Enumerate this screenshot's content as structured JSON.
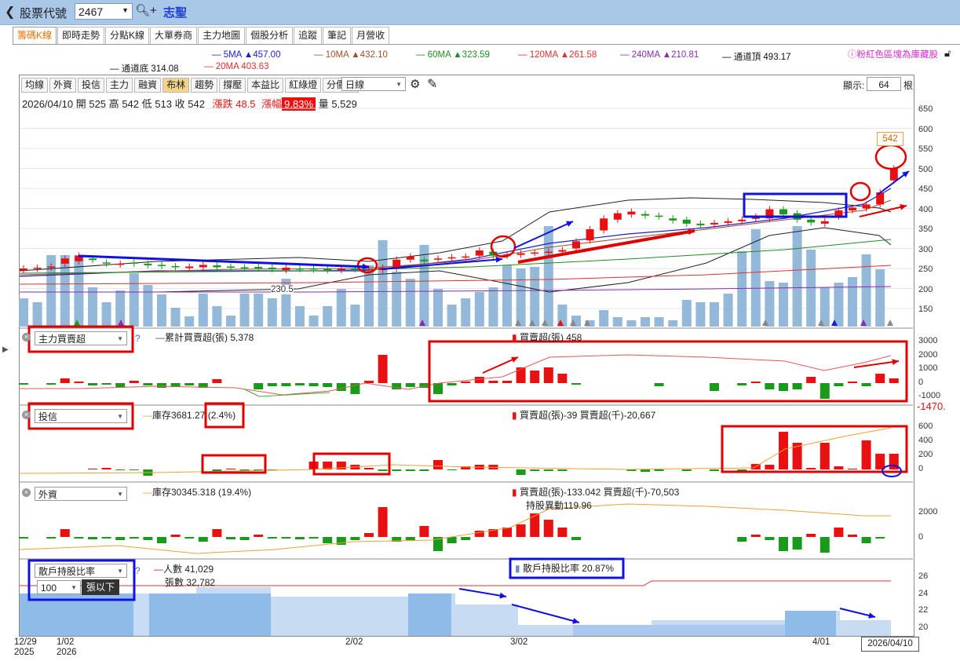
{
  "header": {
    "back_label": "❮",
    "stock_label": "股票代號",
    "stock_code": "2467",
    "stock_name": "志聖"
  },
  "tabs": [
    "籌碼K線",
    "即時走勢",
    "分點K線",
    "大單券商",
    "主力地圖",
    "個股分析",
    "追蹤",
    "筆記",
    "月營收"
  ],
  "ma_legend": [
    {
      "label": "5MA ▲457.00",
      "color": "#1d1dcf"
    },
    {
      "label": "10MA ▲432.10",
      "color": "#a0522d"
    },
    {
      "label": "60MA ▲323.59",
      "color": "#228b22"
    },
    {
      "label": "120MA ▲261.58",
      "color": "#e03030"
    },
    {
      "label": "240MA ▲210.81",
      "color": "#8b2bb0"
    },
    {
      "label": "通道頂 493.17",
      "color": "#111111"
    },
    {
      "label": "通道底 314.08",
      "color": "#111111"
    },
    {
      "label": "20MA 403.63",
      "color": "#e03030"
    }
  ],
  "pink_note": "粉紅色區塊為庫藏股",
  "toolbar": {
    "buttons": [
      "均線",
      "外資",
      "投信",
      "主力",
      "融資",
      "布林",
      "趨勢",
      "撐壓",
      "本益比",
      "紅綠燈",
      "分價量"
    ],
    "period": "日線",
    "display_label": "顯示:",
    "display_count": "64",
    "display_unit": "根"
  },
  "ohlc": {
    "date": "2026/04/10",
    "open_l": "開",
    "open": "525",
    "high_l": "高",
    "high": "542",
    "low_l": "低",
    "low": "513",
    "close_l": "收",
    "close": "542",
    "chg_l": "漲跌",
    "chg": "48.5",
    "pct_l": "漲幅",
    "pct": "9.83%",
    "vol_l": "量",
    "vol": "5,529"
  },
  "price_axis": [
    "650",
    "600",
    "550",
    "500",
    "450",
    "400",
    "350",
    "300",
    "250",
    "200",
    "150"
  ],
  "price_labels": {
    "low_mark": "230.5",
    "last_price": "542"
  },
  "panel1": {
    "select": "主力買賣超",
    "legend1": "累計買賣超(張) 5,378",
    "legend2": "買賣超(張) 458",
    "axis": [
      "3000",
      "2000",
      "1000",
      "0",
      "-1000"
    ]
  },
  "panel2": {
    "select": "投信",
    "legend1": "庫存3681.27",
    "legend1b": "(2.4%)",
    "legend2": "買賣超(張)-39 買賣超(千)-20,667",
    "axis": [
      "600",
      "400",
      "200",
      "0"
    ],
    "side_value": "-1470."
  },
  "panel3": {
    "select": "外資",
    "legend1": "庫存30345.318 (19.4%)",
    "legend2": "買賣超(張)-133.042 買賣超(千)-70,503",
    "legend3": "持股異動119.96",
    "axis": [
      "2000",
      "0"
    ]
  },
  "panel4": {
    "select": "散戶持股比率",
    "sub_select": "100",
    "sub_label": "張以下",
    "legend1": "人數 41,029",
    "legend2": "張數 32,782",
    "legend3": "散戶持股比率 20.87%",
    "axis": [
      "26",
      "24",
      "22",
      "20"
    ]
  },
  "x_axis": [
    {
      "label": "12/29",
      "sub": "2025"
    },
    {
      "label": "1/02",
      "sub": "2026"
    },
    {
      "label": "2/02",
      "sub": ""
    },
    {
      "label": "3/02",
      "sub": ""
    },
    {
      "label": "4/01",
      "sub": ""
    }
  ],
  "x_last": "2026/04/10",
  "colors": {
    "up": "#e81010",
    "down": "#1a9a1a",
    "vol": "#94b8d8"
  }
}
